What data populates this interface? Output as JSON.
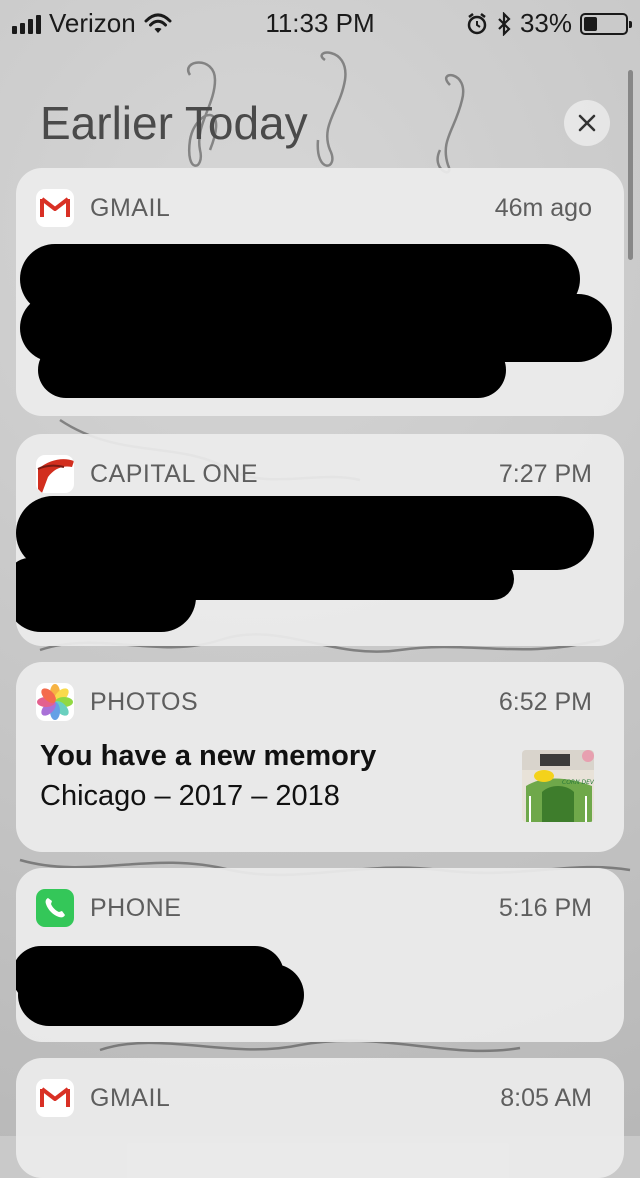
{
  "status_bar": {
    "carrier": "Verizon",
    "time": "11:33 PM",
    "battery": "33%",
    "battery_level": 0.33
  },
  "header": {
    "title": "Earlier Today",
    "close_icon": "close-icon"
  },
  "notifications": [
    {
      "app": "GMAIL",
      "time": "46m ago",
      "icon": "gmail-icon",
      "content_redacted": true
    },
    {
      "app": "CAPITAL ONE",
      "time": "7:27 PM",
      "icon": "capital-one-icon",
      "content_redacted": true
    },
    {
      "app": "PHOTOS",
      "time": "6:52 PM",
      "icon": "photos-icon",
      "title": "You have a new memory",
      "body": "Chicago – 2017 – 2018"
    },
    {
      "app": "PHONE",
      "time": "5:16 PM",
      "icon": "phone-icon",
      "content_redacted": true
    },
    {
      "app": "GMAIL",
      "time": "8:05 AM",
      "icon": "gmail-icon",
      "content_redacted": true
    }
  ],
  "colors": {
    "gmail_red": "#d93025",
    "capital_one_red": "#d22e1e",
    "phone_green": "#34c759"
  }
}
